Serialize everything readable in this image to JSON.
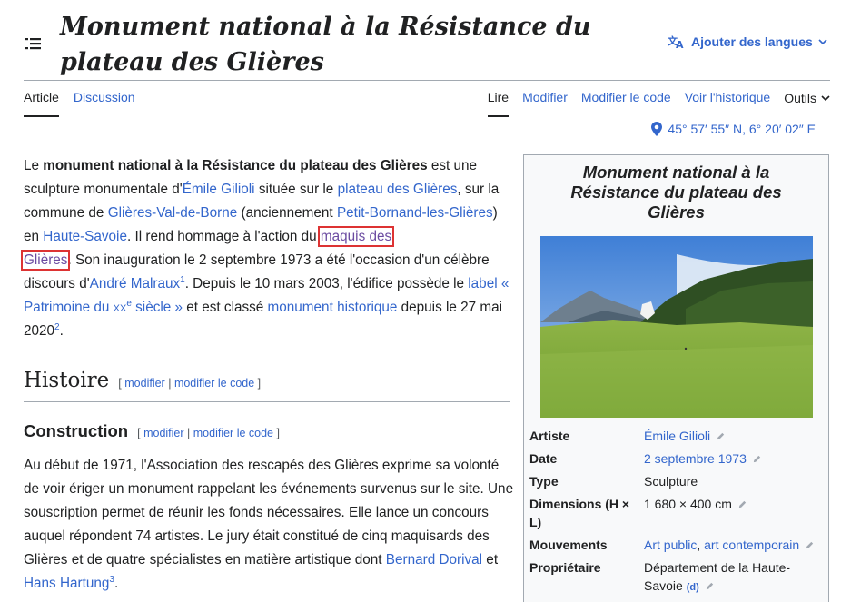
{
  "header": {
    "title": "Monument national à la Résistance du plateau des Glières",
    "lang_button": "Ajouter des langues"
  },
  "tabs": {
    "left": [
      "Article",
      "Discussion"
    ],
    "right": [
      "Lire",
      "Modifier",
      "Modifier le code",
      "Voir l'historique",
      "Outils"
    ]
  },
  "coords": "45° 57′ 55″ N, 6° 20′ 02″ E",
  "intro": {
    "t1": "Le ",
    "bold": "monument national à la Résistance du plateau des Glières",
    "t2": " est une sculpture monumentale d'",
    "link1": "Émile Gilioli",
    "t3": " située sur le ",
    "link2": "plateau des Glières",
    "t4": ", sur la commune de ",
    "link3": "Glières-Val-de-Borne",
    "t5": " (anciennement ",
    "link4": "Petit-Bornand-les-Glières",
    "t6": ") en ",
    "link5": "Haute-Savoie",
    "t7": ". Il rend hommage à l'action du ",
    "link6a": "maquis des",
    "link6b": "Glières",
    "t8": ". Son inauguration le 2 septembre 1973 a été l'occasion d'un célèbre discours d'",
    "link7": "André Malraux",
    "ref1": "1",
    "t9": ". Depuis le 10 mars 2003, l'édifice possède le ",
    "link8a": "label « Patrimoine du ",
    "link8sc": "xx",
    "link8sup": "e",
    "link8b": " siècle »",
    "t10": " et est classé ",
    "link9": "monument historique",
    "t11": " depuis le 27 mai 2020",
    "ref2": "2",
    "t12": "."
  },
  "section": {
    "h2": "Histoire",
    "h3": "Construction",
    "edit": "modifier",
    "edit_code": "modifier le code",
    "sep": "|",
    "open": "[",
    "close": "]"
  },
  "construction": {
    "t1": "Au début de 1971, l'Association des rescapés des Glières exprime sa volonté de voir ériger un monument rappelant les événements survenus sur le site. Une souscription permet de réunir les fonds nécessaires. Elle lance un concours auquel répondent 74 artistes. Le jury était constitué de cinq maquisards des Glières et de quatre spécialistes en matière artistique dont ",
    "link1": "Bernard Dorival",
    "t2": " et ",
    "link2": "Hans Hartung",
    "ref": "3",
    "t3": "."
  },
  "infobox": {
    "title": "Monument national à la Résistance du plateau des Glières",
    "rows": [
      {
        "key": "Artiste",
        "value": "Émile Gilioli"
      },
      {
        "key": "Date",
        "value": "2 septembre 1973"
      },
      {
        "key": "Type",
        "value": "Sculpture"
      },
      {
        "key": "Dimensions (H × L)",
        "value": "1 680 × 400 cm"
      },
      {
        "key": "Mouvements",
        "value1": "Art public",
        "sep": ", ",
        "value2": "art contemporain"
      },
      {
        "key": "Propriétaire",
        "value": "Département de la Haute-Savoie",
        "d": "(d)"
      }
    ]
  },
  "colors": {
    "link": "#3366cc",
    "visited": "#6b4ba1",
    "highlight": "#dd3333",
    "text": "#202122"
  }
}
